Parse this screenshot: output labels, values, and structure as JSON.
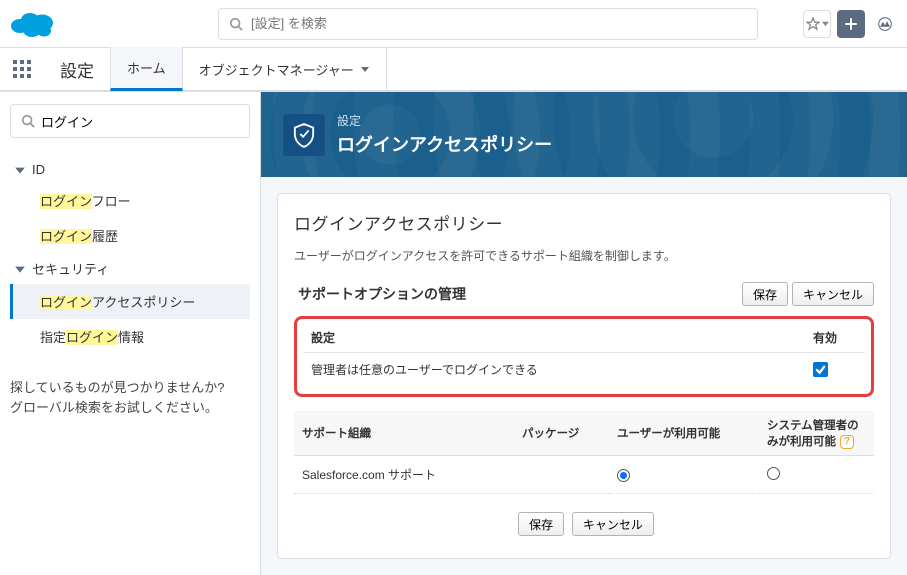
{
  "header": {
    "search_placeholder": "[設定] を検索"
  },
  "nav": {
    "context": "設定",
    "tabs": {
      "home": "ホーム",
      "obj_manager": "オブジェクトマネージャー"
    }
  },
  "sidebar": {
    "quick_find_value": "ログイン",
    "groups": {
      "id": {
        "label": "ID",
        "items": {
          "login_flow": {
            "plain": "フロー"
          },
          "login_history": {
            "plain": "履歴"
          }
        },
        "hl": "ログイン"
      },
      "security": {
        "label": "セキュリティ",
        "items": {
          "login_access": {
            "plain": "アクセスポリシー"
          },
          "login_info": {
            "pre": "指定",
            "plain": "情報"
          }
        },
        "hl": "ログイン"
      }
    },
    "help": {
      "line1": "探しているものが見つかりませんか?",
      "line2": "グローバル検索をお試しください。"
    }
  },
  "hero": {
    "breadcrumb": "設定",
    "title": "ログインアクセスポリシー"
  },
  "panel": {
    "title": "ログインアクセスポリシー",
    "desc": "ユーザーがログインアクセスを許可できるサポート組織を制御します。",
    "section_manage": "サポートオプションの管理",
    "settings_table": {
      "col_setting": "設定",
      "col_enabled": "有効",
      "row1": "管理者は任意のユーザーでログインできる"
    },
    "org_table": {
      "col_org": "サポート組織",
      "col_pkg": "パッケージ",
      "col_user": "ユーザーが利用可能",
      "col_admin": "システム管理者のみが利用可能",
      "row1_org": "Salesforce.com サポート"
    },
    "buttons": {
      "save": "保存",
      "cancel": "キャンセル"
    }
  }
}
